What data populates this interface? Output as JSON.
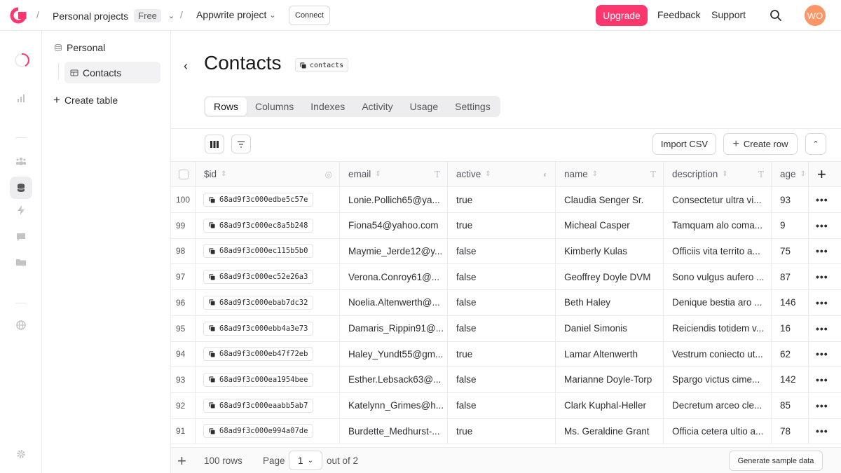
{
  "colors": {
    "brand": "#fd366e",
    "avatar": "#fe9567"
  },
  "breadcrumb": {
    "org": "Personal projects",
    "plan": "Free",
    "project": "Appwrite project",
    "connect_label": "Connect"
  },
  "header": {
    "upgrade_label": "Upgrade",
    "feedback_label": "Feedback",
    "support_label": "Support",
    "avatar_initials": "WO"
  },
  "sidebar": {
    "database_name": "Personal",
    "tables": [
      {
        "label": "Contacts"
      }
    ],
    "create_table_label": "Create table"
  },
  "page": {
    "title": "Contacts",
    "table_id": "contacts"
  },
  "tabs": [
    {
      "label": "Rows",
      "active": true
    },
    {
      "label": "Columns"
    },
    {
      "label": "Indexes"
    },
    {
      "label": "Activity"
    },
    {
      "label": "Usage"
    },
    {
      "label": "Settings"
    }
  ],
  "toolbar": {
    "import_label": "Import CSV",
    "create_row_label": "Create row"
  },
  "table": {
    "columns": [
      "$id",
      "email",
      "active",
      "name",
      "description",
      "age"
    ],
    "rows": [
      {
        "num": "100",
        "id": "68ad9f3c000edbe5c57e",
        "email": "Lonie.Pollich65@ya...",
        "active": "true",
        "name": "Claudia Senger Sr.",
        "description": "Consectetur ultra vi...",
        "age": "93"
      },
      {
        "num": "99",
        "id": "68ad9f3c000ec8a5b248",
        "email": "Fiona54@yahoo.com",
        "active": "true",
        "name": "Micheal Casper",
        "description": "Tamquam alo coma...",
        "age": "9"
      },
      {
        "num": "98",
        "id": "68ad9f3c000ec115b5b0",
        "email": "Maymie_Jerde12@y...",
        "active": "false",
        "name": "Kimberly Kulas",
        "description": "Officiis vita territo a...",
        "age": "75"
      },
      {
        "num": "97",
        "id": "68ad9f3c000ec52e26a3",
        "email": "Verona.Conroy61@...",
        "active": "false",
        "name": "Geoffrey Doyle DVM",
        "description": "Sono vulgus aufero ...",
        "age": "87"
      },
      {
        "num": "96",
        "id": "68ad9f3c000ebab7dc32",
        "email": "Noelia.Altenwerth@...",
        "active": "false",
        "name": "Beth Haley",
        "description": "Denique bestia aro ...",
        "age": "146"
      },
      {
        "num": "95",
        "id": "68ad9f3c000ebb4a3e73",
        "email": "Damaris_Rippin91@...",
        "active": "false",
        "name": "Daniel Simonis",
        "description": "Reiciendis totidem v...",
        "age": "16"
      },
      {
        "num": "94",
        "id": "68ad9f3c000eb47f72eb",
        "email": "Haley_Yundt55@gm...",
        "active": "true",
        "name": "Lamar Altenwerth",
        "description": "Vestrum coniecto ut...",
        "age": "62"
      },
      {
        "num": "93",
        "id": "68ad9f3c000ea1954bee",
        "email": "Esther.Lebsack63@...",
        "active": "false",
        "name": "Marianne Doyle-Torp",
        "description": "Spargo victus cime...",
        "age": "142"
      },
      {
        "num": "92",
        "id": "68ad9f3c000eaabb5ab7",
        "email": "Katelynn_Grimes@h...",
        "active": "false",
        "name": "Clark Kuphal-Heller",
        "description": "Decretum arceo cle...",
        "age": "85"
      },
      {
        "num": "91",
        "id": "68ad9f3c000e994a07de",
        "email": "Burdette_Medhurst-...",
        "active": "true",
        "name": "Ms. Geraldine Grant",
        "description": "Officia cetera ultio a...",
        "age": "78"
      }
    ]
  },
  "footer": {
    "rows_count": "100 rows",
    "page_label": "Page",
    "current_page": "1",
    "out_of": "out of 2",
    "generate_label": "Generate sample data"
  }
}
